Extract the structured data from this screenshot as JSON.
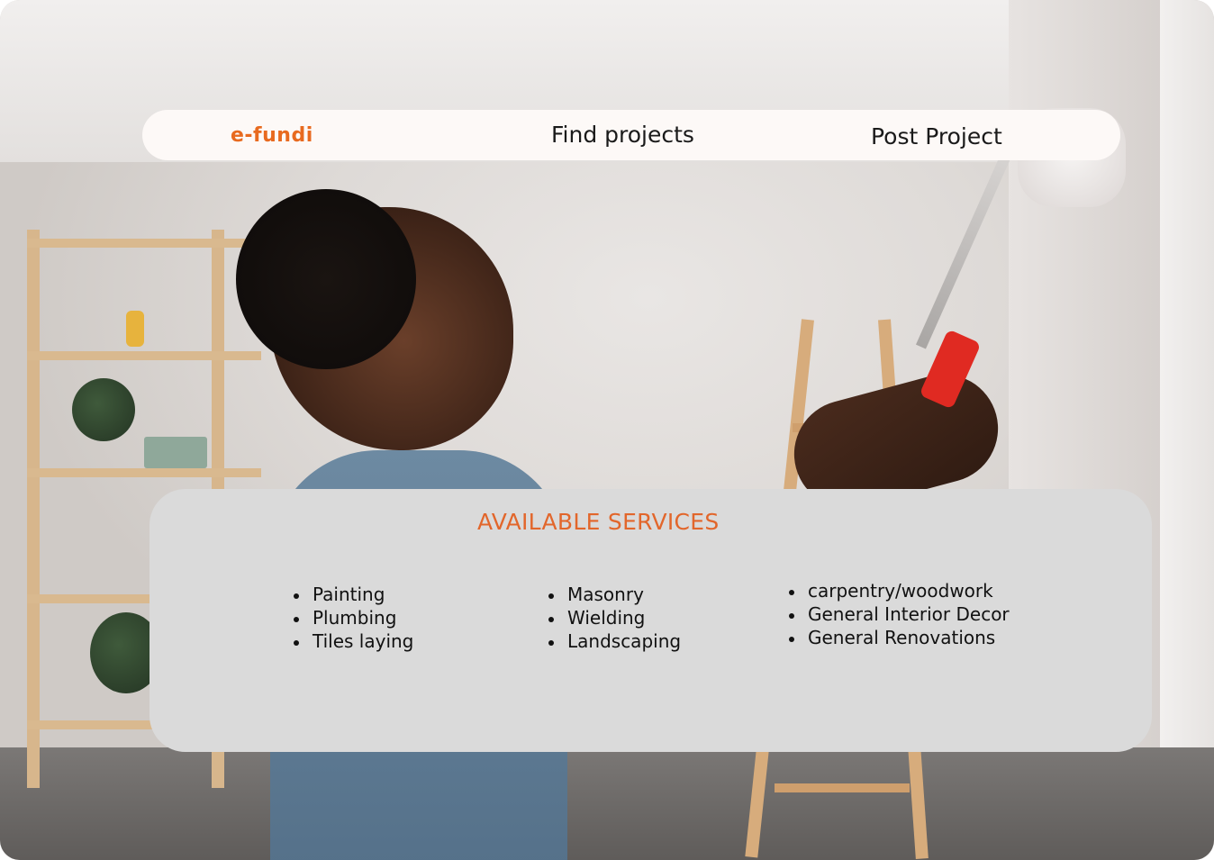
{
  "nav": {
    "logo": "e-fundi",
    "find_projects": "Find projects",
    "post_project": "Post Project"
  },
  "services": {
    "title": "AVAILABLE SERVICES",
    "columns": [
      [
        "Painting",
        "Plumbing",
        "Tiles laying"
      ],
      [
        "Masonry",
        "Wielding",
        "Landscaping"
      ],
      [
        "carpentry/woodwork",
        "General Interior Decor",
        "General Renovations"
      ]
    ]
  },
  "colors": {
    "brand": "#e86a1f",
    "panel": "#dadada",
    "nav_bg": "#fdf9f7"
  },
  "background": {
    "icon": "hero-photo-painter"
  }
}
